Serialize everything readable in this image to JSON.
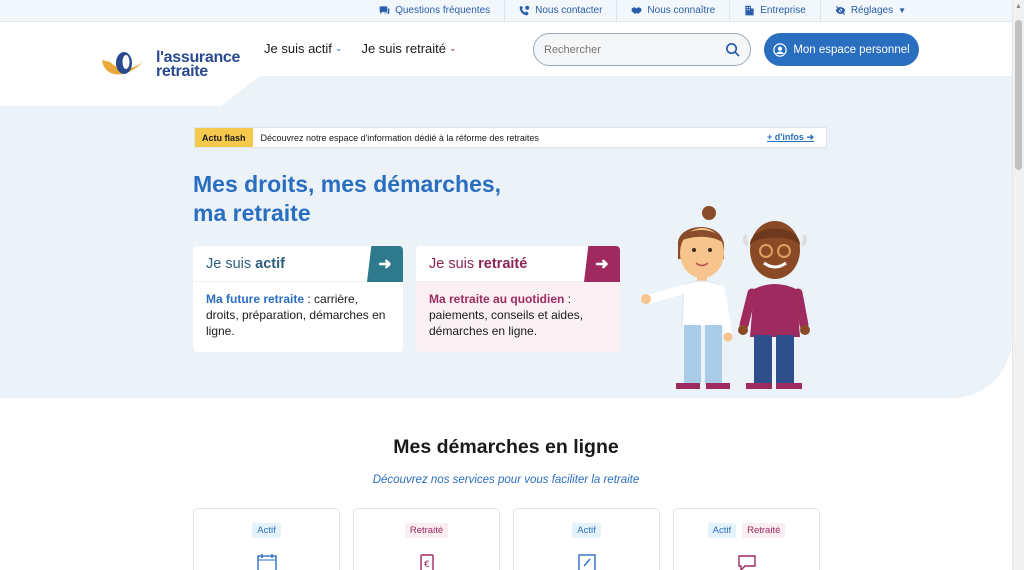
{
  "utility": {
    "faq": "Questions fréquentes",
    "contact": "Nous contacter",
    "about": "Nous connaître",
    "business": "Entreprise",
    "settings": "Réglages"
  },
  "logo": {
    "line1": "l'assurance",
    "line2": "retraite"
  },
  "nav": {
    "actif": "Je suis actif",
    "retraite": "Je suis retraité"
  },
  "search": {
    "placeholder": "Rechercher"
  },
  "espace_button": "Mon espace personnel",
  "flash": {
    "tag": "Actu flash",
    "message": "Découvrez notre espace d'information dédié à la réforme des retraites",
    "link": "+ d'infos"
  },
  "hero": {
    "title_line1": "Mes droits, mes démarches,",
    "title_line2": "ma retraite"
  },
  "cards": {
    "actif": {
      "head_prefix": "Je suis",
      "head_bold": "actif",
      "body_bold": "Ma future retraite",
      "body_text": " : carrière, droits, préparation, démarches en ligne."
    },
    "retraite": {
      "head_prefix": "Je suis",
      "head_bold": "retraité",
      "body_bold": "Ma retraite au quotidien",
      "body_text": " : paiements, conseils et aides, démarches en ligne."
    }
  },
  "section": {
    "title": "Mes démarches en ligne",
    "subtitle": "Découvrez nos services pour vous faciliter la retraite"
  },
  "services": [
    {
      "badges": [
        "Actif"
      ],
      "icon": "calendar-icon"
    },
    {
      "badges": [
        "Retraité"
      ],
      "icon": "euro-document-icon"
    },
    {
      "badges": [
        "Actif"
      ],
      "icon": "document-edit-icon"
    },
    {
      "badges": [
        "Actif",
        "Retraité"
      ],
      "icon": "chat-icon"
    }
  ],
  "colors": {
    "primary": "#2a6ec0",
    "actif_accent": "#2e7a8c",
    "retraite_accent": "#9e2a5f",
    "flash_tag": "#f5c94b",
    "hero_bg": "#ecf3f8"
  }
}
